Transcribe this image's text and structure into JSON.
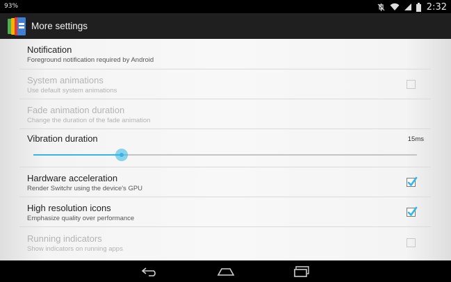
{
  "status_bar": {
    "battery": "93%",
    "time": "2:32",
    "icons": [
      "mute-icon",
      "wifi-icon",
      "signal-icon",
      "battery-icon"
    ]
  },
  "action_bar": {
    "title": "More settings",
    "app_icon": "switchr-app-icon"
  },
  "settings": {
    "notification": {
      "title": "Notification",
      "summary": "Foreground notification required by Android",
      "enabled": true
    },
    "system_animations": {
      "title": "System animations",
      "summary": "Use default system animations",
      "enabled": false,
      "checked": false
    },
    "fade_animation": {
      "title": "Fade animation duration",
      "summary": "Change the duration of the fade animation",
      "enabled": false
    },
    "vibration": {
      "title": "Vibration duration",
      "value_label": "15ms",
      "fraction": 0.23
    },
    "hardware_acceleration": {
      "title": "Hardware acceleration",
      "summary": "Render Switchr using the device's GPU",
      "enabled": true,
      "checked": true
    },
    "high_res_icons": {
      "title": "High resolution icons",
      "summary": "Emphasize quality over performance",
      "enabled": true,
      "checked": true
    },
    "running_indicators": {
      "title": "Running indicators",
      "summary": "Show indicators on running apps",
      "enabled": false,
      "checked": false
    }
  },
  "nav_bar": {
    "buttons": [
      "back-icon",
      "home-icon",
      "recents-icon"
    ]
  },
  "colors": {
    "accent": "#33b5e5",
    "action_bar": "#1f1f1f",
    "disabled_text": "#b3b3b3"
  }
}
